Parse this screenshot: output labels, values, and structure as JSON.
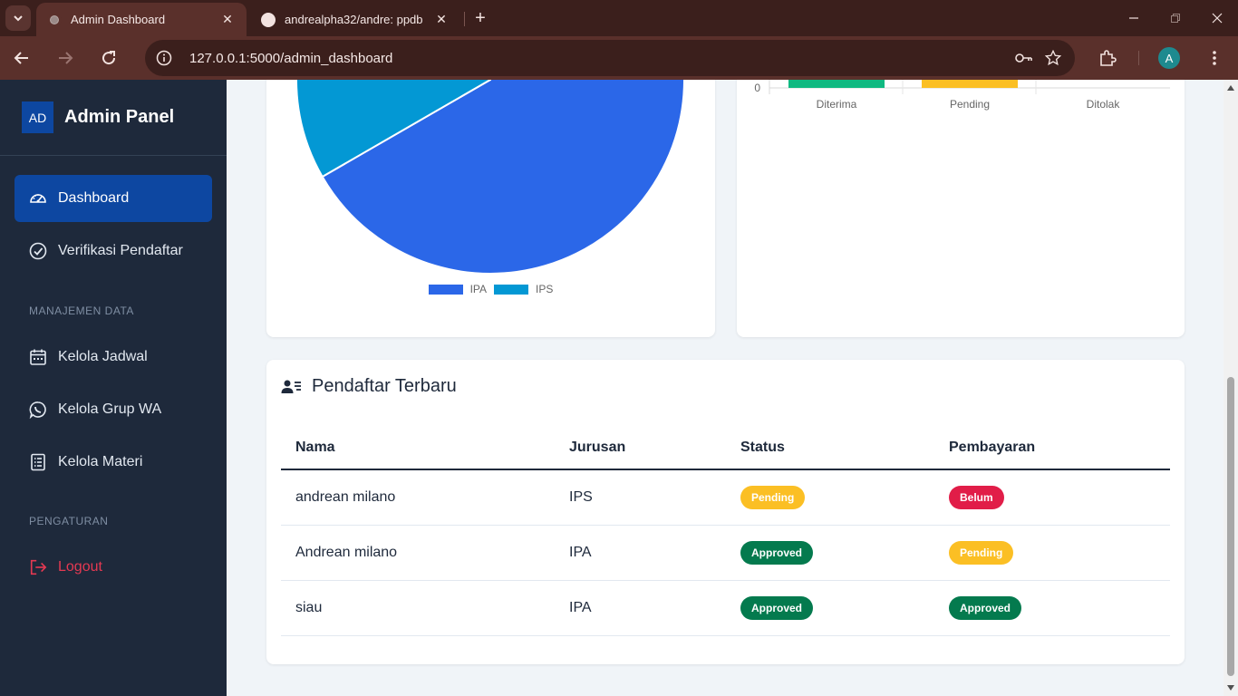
{
  "browser": {
    "tabs": [
      {
        "title": "Admin Dashboard",
        "active": true
      },
      {
        "title": "andrealpha32/andre: ppdb",
        "active": false
      }
    ],
    "url": "127.0.0.1:5000/admin_dashboard",
    "profile_initial": "A"
  },
  "sidebar": {
    "logo": "AD",
    "brand": "Admin Panel",
    "items": [
      {
        "label": "Dashboard",
        "icon": "speedometer-icon",
        "active": true
      },
      {
        "label": "Verifikasi Pendaftar",
        "icon": "check-circle-icon"
      }
    ],
    "section_data": "MANAJEMEN DATA",
    "data_items": [
      {
        "label": "Kelola Jadwal",
        "icon": "calendar-icon"
      },
      {
        "label": "Kelola Grup WA",
        "icon": "whatsapp-icon"
      },
      {
        "label": "Kelola Materi",
        "icon": "document-list-icon"
      }
    ],
    "section_settings": "PENGATURAN",
    "logout": "Logout"
  },
  "colors": {
    "accent": "#0d47a1",
    "sidebar_bg": "#1e293b",
    "ipa": "#2b67e8",
    "ips": "#0398d4",
    "diterima": "#10b981",
    "pending": "#fbbf24"
  },
  "chart_data": [
    {
      "type": "pie",
      "labels": [
        "IPA",
        "IPS"
      ],
      "values": [
        2,
        1
      ],
      "legend_position": "bottom"
    },
    {
      "type": "bar",
      "categories": [
        "Diterima",
        "Pending",
        "Ditolak"
      ],
      "visible_y_ticks": [
        "0"
      ]
    }
  ],
  "registrants": {
    "title": "Pendaftar Terbaru",
    "columns": [
      "Nama",
      "Jurusan",
      "Status",
      "Pembayaran"
    ],
    "rows": [
      {
        "nama": "andrean milano",
        "jurusan": "IPS",
        "status": "Pending",
        "pembayaran": "Belum"
      },
      {
        "nama": "Andrean milano",
        "jurusan": "IPA",
        "status": "Approved",
        "pembayaran": "Pending"
      },
      {
        "nama": "siau",
        "jurusan": "IPA",
        "status": "Approved",
        "pembayaran": "Approved"
      }
    ]
  }
}
